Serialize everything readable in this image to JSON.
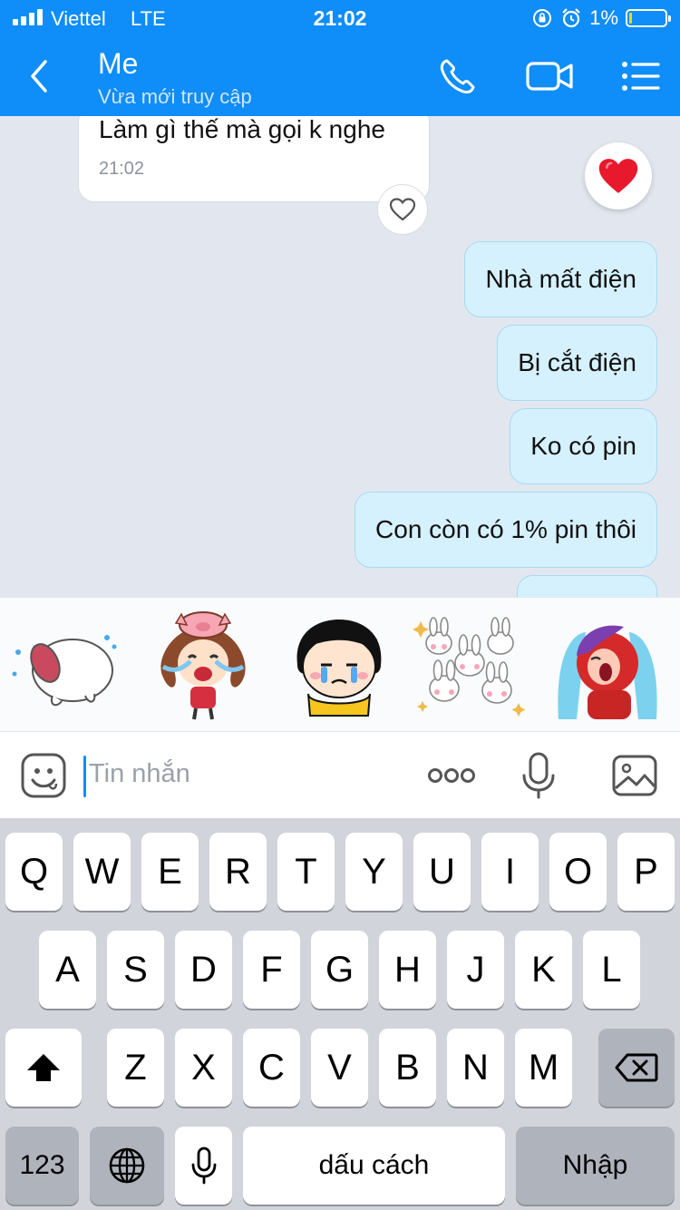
{
  "status_bar": {
    "carrier": "Viettel",
    "network": "LTE",
    "time": "21:02",
    "battery_percent": "1%",
    "battery_level": 0.01,
    "icons": [
      "signal-icon",
      "rotation-lock-icon",
      "alarm-icon",
      "battery-icon"
    ]
  },
  "header": {
    "title": "Me",
    "subtitle": "Vừa mới truy cập",
    "icons": [
      "back-icon",
      "phone-icon",
      "video-call-icon",
      "menu-icon"
    ]
  },
  "chat": {
    "incoming": [
      {
        "text": "Làm gì thế mà gọi k nghe",
        "time": "21:02"
      }
    ],
    "outgoing": [
      {
        "text": "Nhà mất điện"
      },
      {
        "text": "Bị cắt điện"
      },
      {
        "text": "Ko có pin"
      },
      {
        "text": "Con còn có 1% pin thôi"
      }
    ]
  },
  "stickers": [
    "crying-cat-sticker",
    "crying-pig-girl-sticker",
    "crying-girl-sticker",
    "rabbits-sticker",
    "crying-red-character-sticker"
  ],
  "input": {
    "placeholder": "Tin nhắn",
    "icons": [
      "emoji-icon",
      "more-icon",
      "microphone-icon",
      "image-icon"
    ]
  },
  "keyboard": {
    "row1": [
      "Q",
      "W",
      "E",
      "R",
      "T",
      "Y",
      "U",
      "I",
      "O",
      "P"
    ],
    "row2": [
      "A",
      "S",
      "D",
      "F",
      "G",
      "H",
      "J",
      "K",
      "L"
    ],
    "row3": [
      "Z",
      "X",
      "C",
      "V",
      "B",
      "N",
      "M"
    ],
    "numbers_key": "123",
    "space_key": "dấu cách",
    "return_key": "Nhập",
    "icons": [
      "shift-icon",
      "backspace-icon",
      "globe-icon",
      "dictation-icon"
    ]
  },
  "colors": {
    "header": "#0f8df8",
    "chat_background": "#e2e7ef",
    "outgoing_bubble": "#d5f1fe",
    "heart": "#e8192c"
  }
}
